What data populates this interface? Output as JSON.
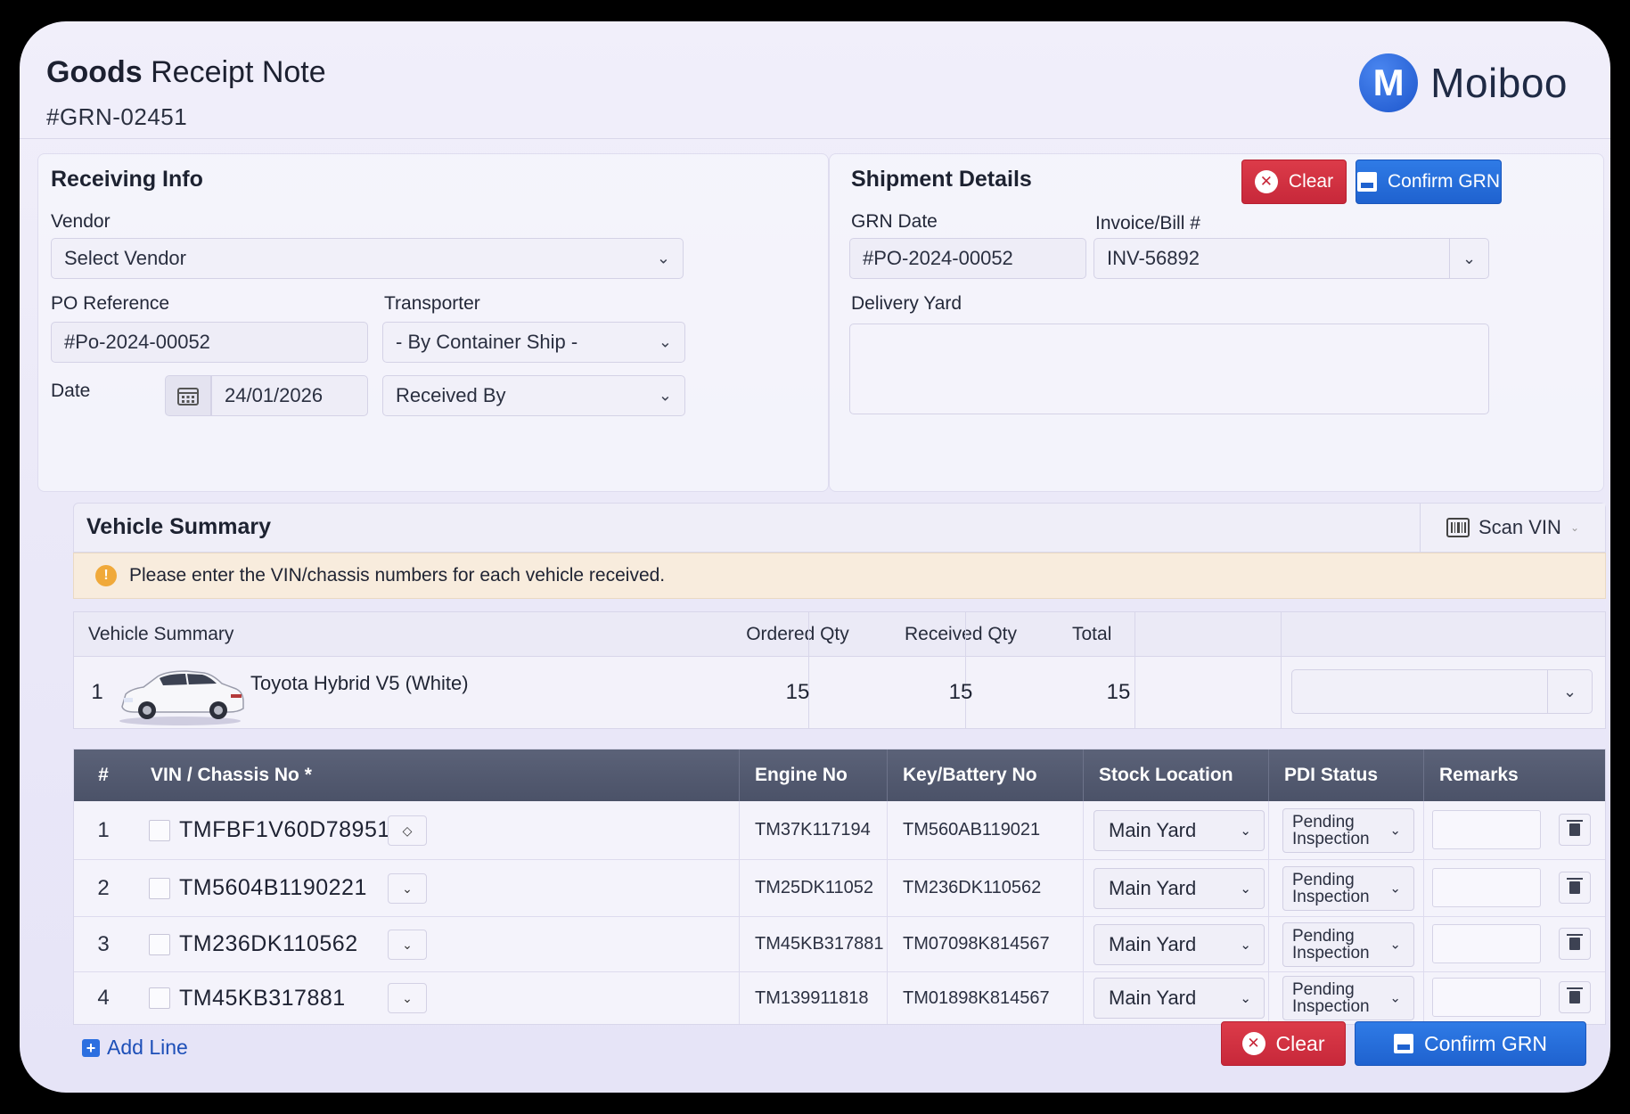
{
  "header": {
    "title_bold": "Goods",
    "title_rest": " Receipt Note",
    "grn_number": "#GRN-02451",
    "logo_letter": "M",
    "logo_text": "Moiboo"
  },
  "receiving": {
    "title": "Receiving Info",
    "vendor_label": "Vendor",
    "vendor_value": "Select Vendor",
    "po_label": "PO Reference",
    "po_value": "#Po-2024-00052",
    "transporter_label": "Transporter",
    "transporter_value": "- By Container Ship -",
    "date_label": "Date",
    "date_value": "24/01/2026",
    "received_by_value": "Received By"
  },
  "shipment": {
    "title": "Shipment Details",
    "grn_date_label": "GRN Date",
    "grn_date_value": "#PO-2024-00052",
    "invoice_label": "Invoice/Bill #",
    "invoice_value": "INV-56892",
    "delivery_yard_label": "Delivery Yard"
  },
  "actions": {
    "clear_label": "Clear",
    "confirm_label": "Confirm GRN",
    "add_line_label": "Add Line"
  },
  "vehicle_summary": {
    "title": "Vehicle Summary",
    "scan_label": "Scan VIN",
    "alert_text": "Please enter the VIN/chassis numbers for each vehicle received.",
    "columns": [
      "Vehicle Summary",
      "Ordered Qty",
      "Received Qty",
      "Total"
    ],
    "row": {
      "index": "1",
      "vehicle": "Toyota Hybrid  V5 (White)",
      "ordered": "15",
      "received": "15",
      "total": "15"
    }
  },
  "vin_table": {
    "columns": [
      "#",
      "VIN / Chassis No *",
      "Engine No",
      "Key/Battery No",
      "Stock Location",
      "PDI Status",
      "Remarks"
    ],
    "rows": [
      {
        "index": "1",
        "vin": "TMFBF1V60D78951",
        "engine": "TM37K117194",
        "key": "TM560AB119021",
        "location": "Main Yard",
        "pdi_line1": "Pending",
        "pdi_line2": "Inspection"
      },
      {
        "index": "2",
        "vin": "TM5604B1190221",
        "engine": "TM25DK11052",
        "key": "TM236DK110562",
        "location": "Main Yard",
        "pdi_line1": "Pending",
        "pdi_line2": "Inspection"
      },
      {
        "index": "3",
        "vin": "TM236DK110562",
        "engine": "TM45KB317881",
        "key": "TM07098K814567",
        "location": "Main Yard",
        "pdi_line1": "Pending",
        "pdi_line2": "Inspection"
      },
      {
        "index": "4",
        "vin": "TM45KB317881",
        "engine": "TM139911818",
        "key": "TM01898K814567",
        "location": "Main Yard",
        "pdi_line1": "Pending",
        "pdi_line2": "Inspection"
      }
    ]
  },
  "icons": {
    "calendar": "calendar-icon",
    "chevron": "chevron-down-icon",
    "clear": "x-circle-icon",
    "confirm": "save-icon",
    "scan": "barcode-icon",
    "warning": "warning-icon",
    "trash": "trash-icon",
    "add": "plus-icon"
  },
  "colors": {
    "accent_blue": "#1f62cf",
    "danger_red": "#c7283a",
    "table_header": "#4b5268",
    "alert_bg": "#f8ecdd"
  }
}
